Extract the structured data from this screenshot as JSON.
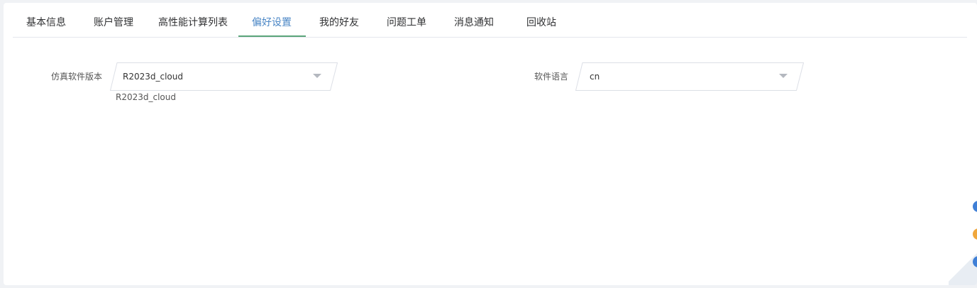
{
  "tabs": [
    {
      "label": "基本信息"
    },
    {
      "label": "账户管理"
    },
    {
      "label": "高性能计算列表"
    },
    {
      "label": "偏好设置",
      "active": true
    },
    {
      "label": "我的好友"
    },
    {
      "label": "问题工单"
    },
    {
      "label": "消息通知"
    },
    {
      "label": "回收站"
    }
  ],
  "form": {
    "version": {
      "label": "仿真软件版本",
      "value": "R2023d_cloud",
      "helper": "R2023d_cloud"
    },
    "language": {
      "label": "软件语言",
      "value": "cn"
    }
  },
  "colors": {
    "active_tab": "#4a86c5",
    "tab_ink": "#5aa57a",
    "float_blue": "#3f7fd6",
    "float_orange": "#f0a73c"
  },
  "icons": {
    "select_arrow": "caret-down-icon"
  }
}
